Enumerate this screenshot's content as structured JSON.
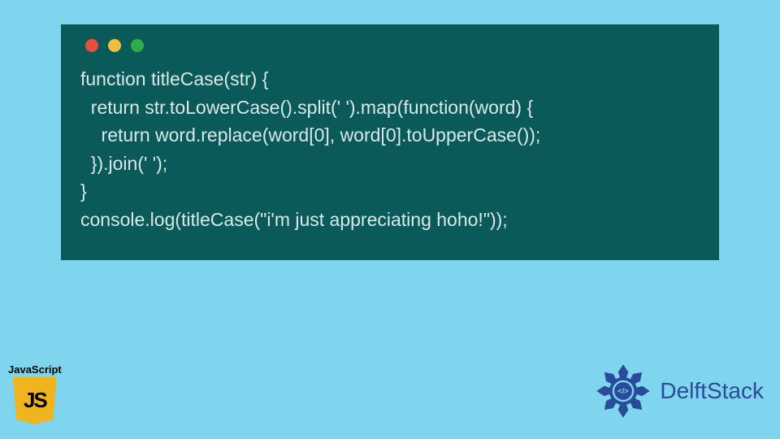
{
  "code": {
    "line1": "function titleCase(str) {",
    "line2": "  return str.toLowerCase().split(' ').map(function(word) {",
    "line3": "    return word.replace(word[0], word[0].toUpperCase());",
    "line4": "  }).join(' ');",
    "line5": "}",
    "line6": "console.log(titleCase(\"i'm just appreciating hoho!\"));"
  },
  "jsBadge": {
    "label": "JavaScript",
    "iconText": "JS"
  },
  "delft": {
    "brandName": "DelftStack",
    "centerGlyph": "</>"
  }
}
